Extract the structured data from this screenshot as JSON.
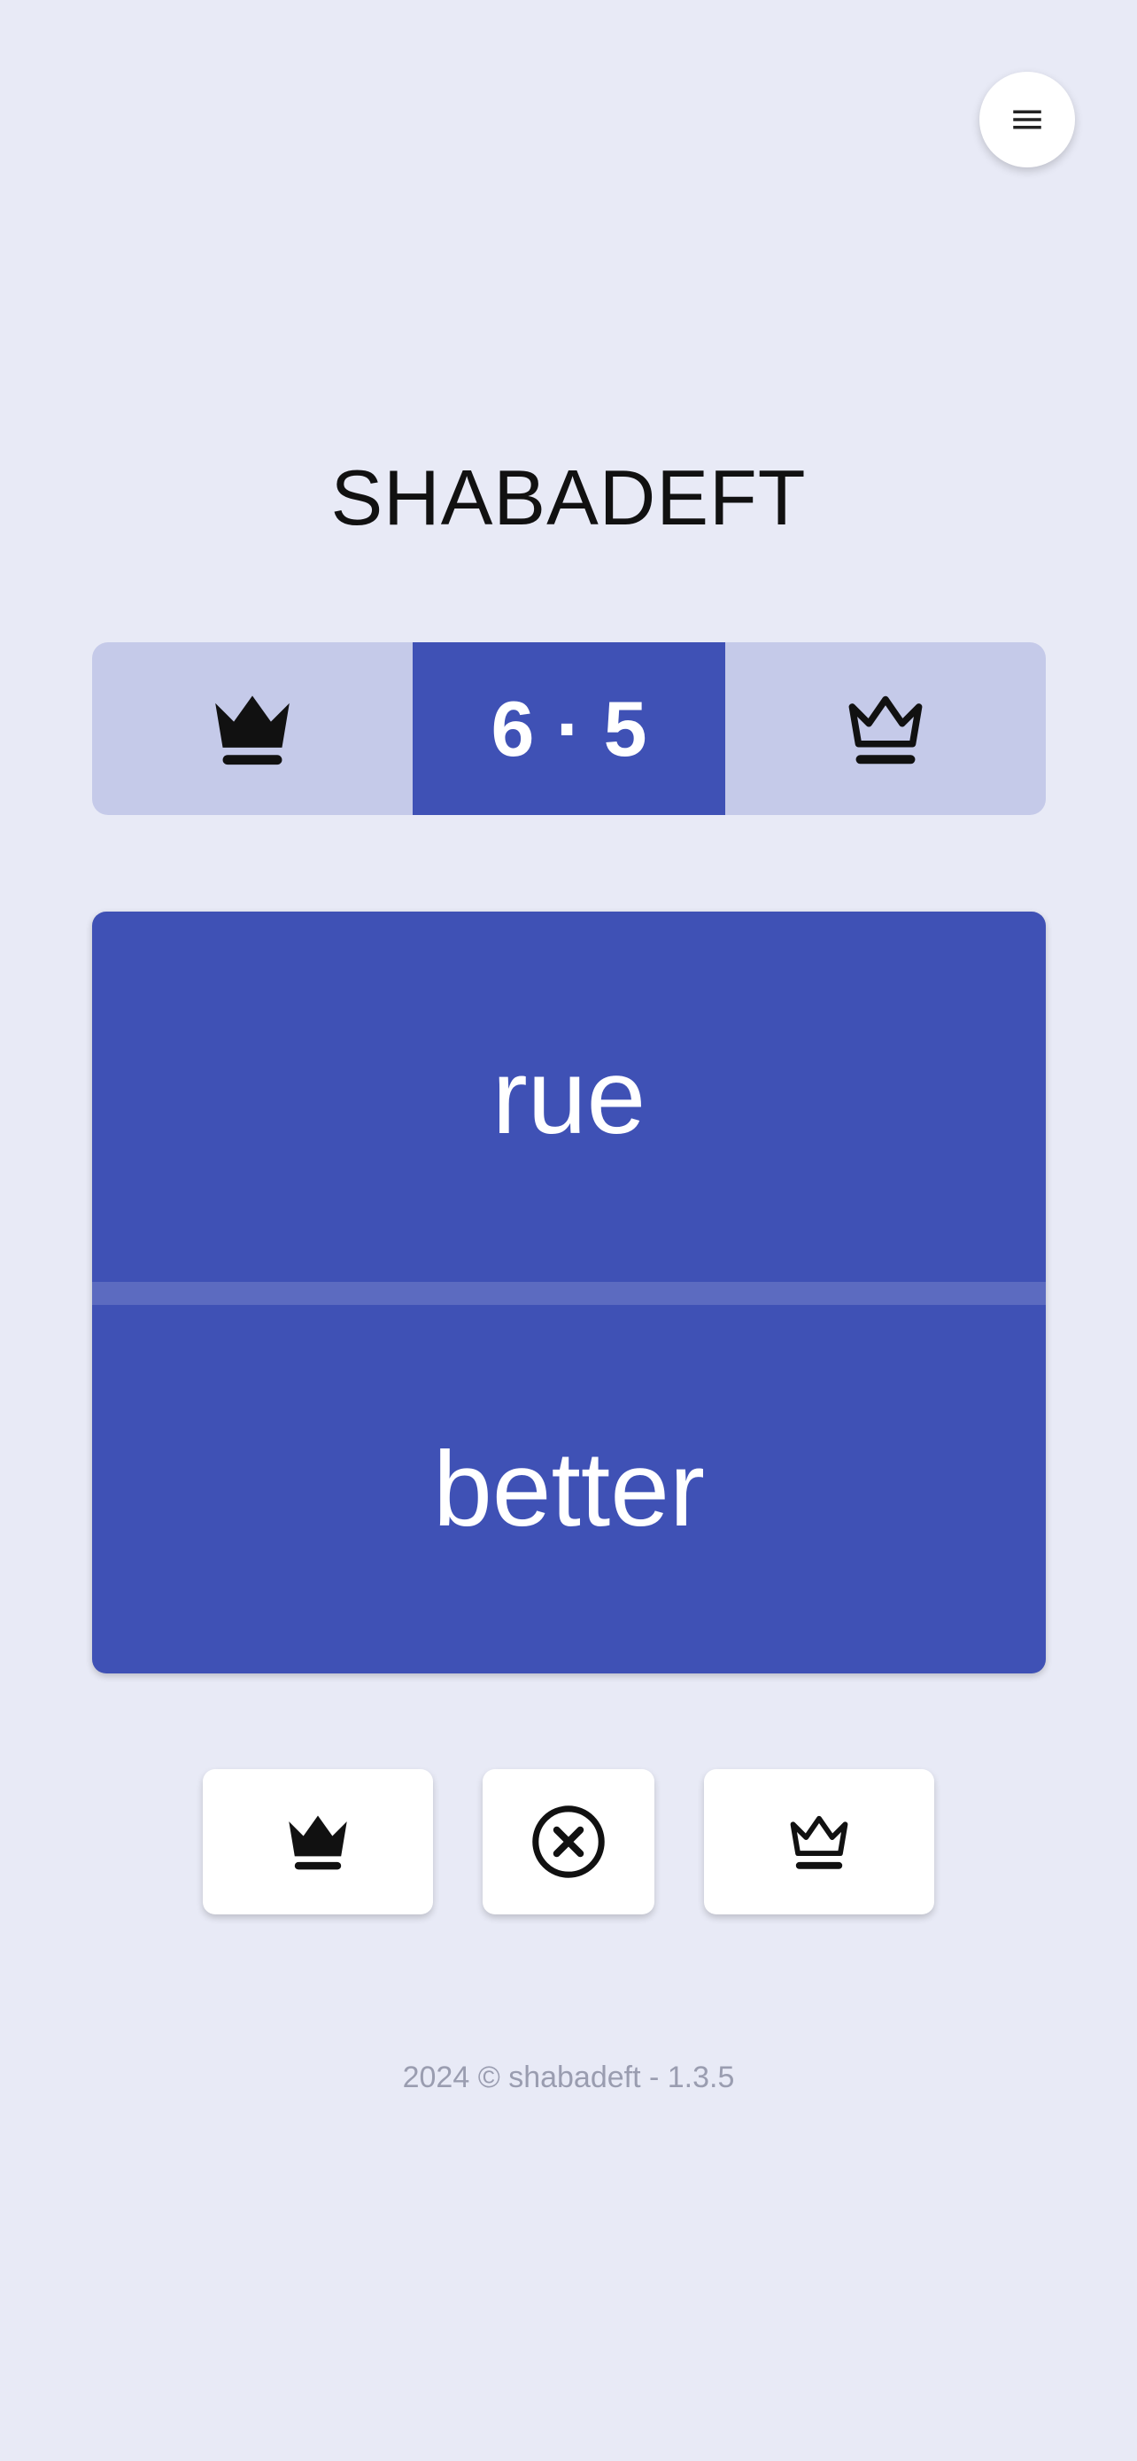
{
  "header": {
    "title": "SHABADEFT",
    "menu_icon": "menu-icon"
  },
  "scoreboard": {
    "left_icon": "crown-filled-icon",
    "score_display": "6 · 5",
    "right_icon": "crown-outline-icon"
  },
  "card": {
    "top_word": "rue",
    "bottom_word": "better"
  },
  "actions": [
    {
      "icon": "crown-filled-icon"
    },
    {
      "icon": "close-circle-icon"
    },
    {
      "icon": "crown-outline-icon"
    }
  ],
  "footer": {
    "text": "2024 © shabadeft - 1.3.5"
  },
  "colors": {
    "background": "#e8eaf6",
    "primary": "#3f51b5",
    "primary_light": "#c5cae9",
    "divider": "#5c6bc0"
  }
}
